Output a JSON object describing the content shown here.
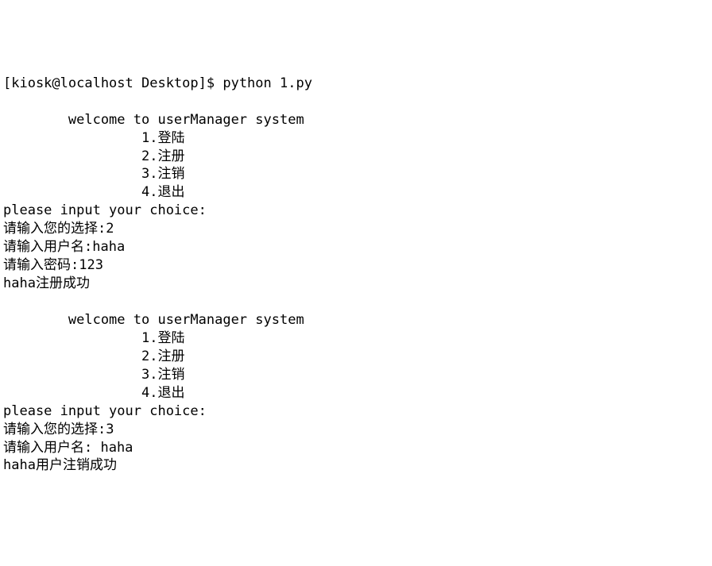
{
  "terminal": {
    "prompt": "[kiosk@localhost Desktop]$ ",
    "command": "python 1.py",
    "menu_header": "        welcome to userManager system",
    "menu_items": [
      "                 1.登陆",
      "                 2.注册",
      "                 3.注销",
      "                 4.退出"
    ],
    "choice_prompt_en": "please input your choice:",
    "session1": {
      "choice_line": "请输入您的选择:2",
      "username_line": "请输入用户名:haha",
      "password_line": "请输入密码:123",
      "result_line": "haha注册成功"
    },
    "session2": {
      "choice_line": "请输入您的选择:3",
      "username_line": "请输入用户名: haha",
      "result_line": "haha用户注销成功"
    }
  }
}
